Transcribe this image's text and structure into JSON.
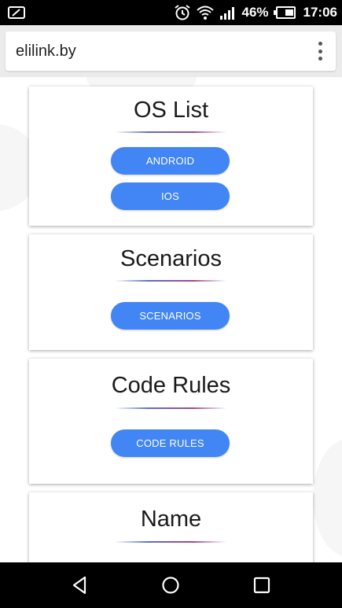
{
  "status_bar": {
    "battery_percent": "46%",
    "time": "17:06",
    "icons": [
      "notification-icon",
      "alarm-icon",
      "wifi-icon",
      "signal-icon",
      "battery-icon"
    ]
  },
  "browser": {
    "url": "elilink.by",
    "menu_icon": "more-vert-icon"
  },
  "cards": [
    {
      "title": "OS List",
      "buttons": [
        "ANDROID",
        "IOS"
      ]
    },
    {
      "title": "Scenarios",
      "buttons": [
        "SCENARIOS"
      ]
    },
    {
      "title": "Code Rules",
      "buttons": [
        "CODE RULES"
      ]
    },
    {
      "title": "Name",
      "buttons": []
    }
  ],
  "nav_bar": {
    "icons": [
      "back-icon",
      "home-icon",
      "recents-icon"
    ]
  },
  "colors": {
    "button": "#4285f4",
    "divider_start": "#5a6fd0",
    "divider_end": "#a04a8a"
  }
}
